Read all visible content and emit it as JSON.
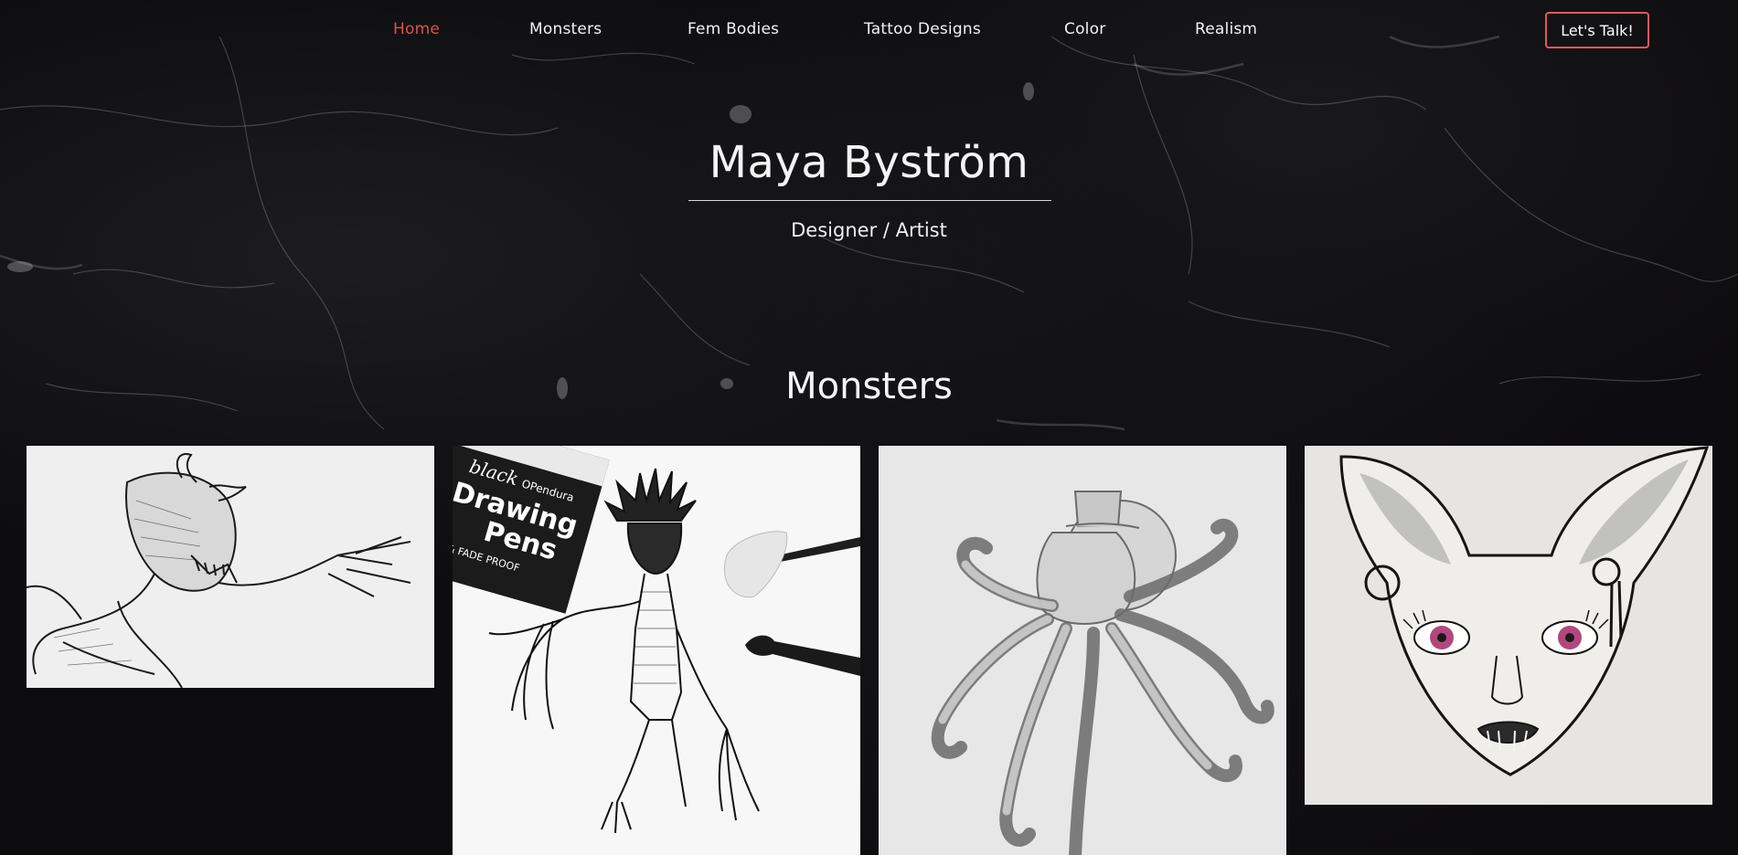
{
  "nav": {
    "items": [
      {
        "label": "Home",
        "active": true
      },
      {
        "label": "Monsters",
        "active": false
      },
      {
        "label": "Fem Bodies",
        "active": false
      },
      {
        "label": "Tattoo Designs",
        "active": false
      },
      {
        "label": "Color",
        "active": false
      },
      {
        "label": "Realism",
        "active": false
      }
    ],
    "cta_label": "Let's Talk!"
  },
  "hero": {
    "title": "Maya Byström",
    "subtitle": "Designer / Artist"
  },
  "gallery": {
    "section_title": "Monsters",
    "pens_box_text": [
      "black",
      "Drawing",
      "Pens",
      "R & FADE PROOF",
      "OPendura"
    ]
  },
  "colors": {
    "accent": "#d9534f",
    "cta_border": "#e05a5e",
    "background": "#0c0b0d"
  }
}
